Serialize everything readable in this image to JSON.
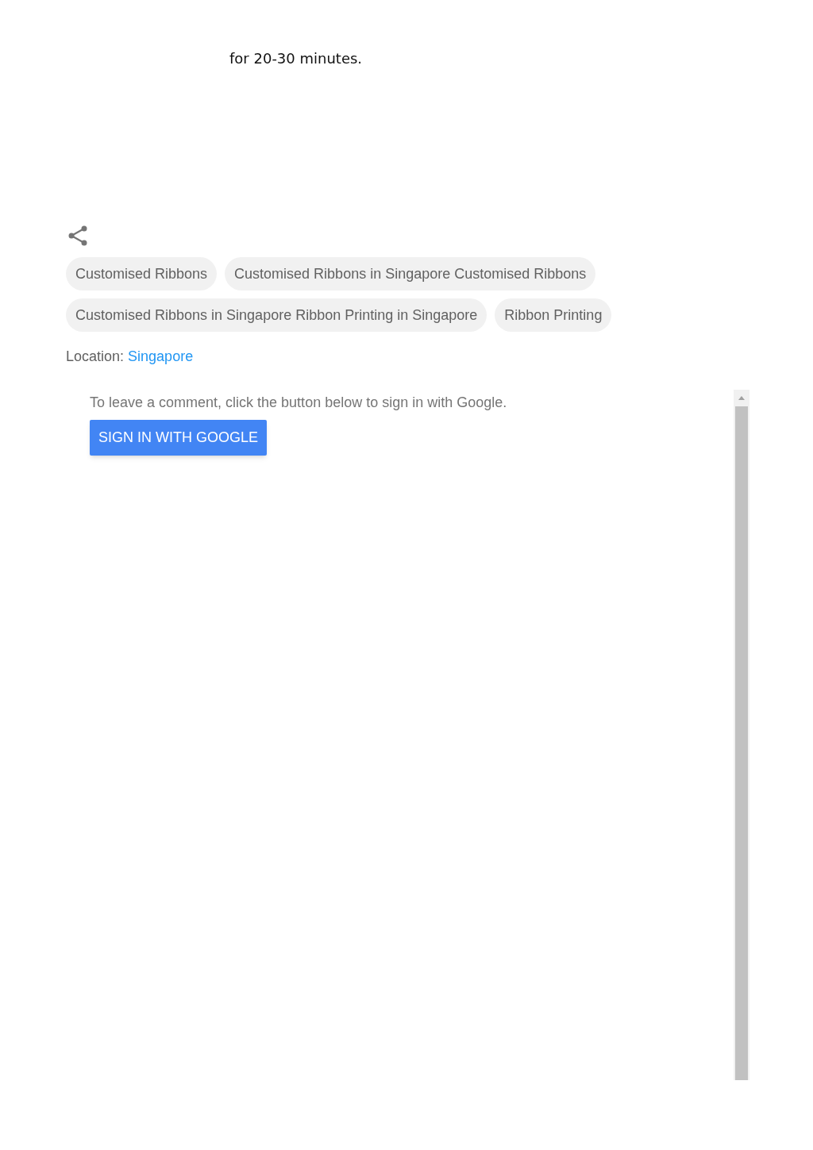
{
  "body_text": "for 20-30 minutes.",
  "labels": [
    {
      "text": "Customised Ribbons"
    },
    {
      "text": "Customised Ribbons in Singapore Customised Ribbons"
    },
    {
      "text": "Customised Ribbons in Singapore Ribbon Printing in Singapore"
    },
    {
      "text": "Ribbon Printing"
    }
  ],
  "location": {
    "label": "Location:",
    "value": "Singapore"
  },
  "comments": {
    "prompt": "To leave a comment, click the button below to sign in with Google.",
    "button": "SIGN IN WITH GOOGLE"
  }
}
